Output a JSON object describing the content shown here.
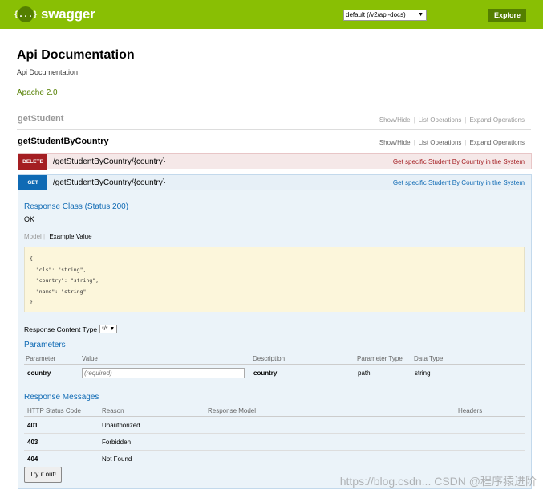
{
  "header": {
    "logo_icon": "{...}",
    "logo_text": "swagger",
    "api_select": "default (/v2/api-docs)",
    "api_select_arrow": "▼",
    "explore": "Explore",
    "bg_color": "#89bf04"
  },
  "info": {
    "title": "Api Documentation",
    "description": "Api Documentation",
    "license": "Apache 2.0"
  },
  "resources": [
    {
      "name": "getStudent",
      "actions": [
        "Show/Hide",
        "List Operations",
        "Expand Operations"
      ]
    },
    {
      "name": "getStudentByCountry",
      "actions": [
        "Show/Hide",
        "List Operations",
        "Expand Operations"
      ]
    }
  ],
  "operations": {
    "delete": {
      "method": "DELETE",
      "path": "/getStudentByCountry/{country}",
      "summary": "Get specific Student By Country in the System",
      "color": "#a41e22"
    },
    "get": {
      "method": "GET",
      "path": "/getStudentByCountry/{country}",
      "summary": "Get specific Student By Country in the System",
      "color": "#0f6ab4"
    }
  },
  "response_class": {
    "title": "Response Class (Status 200)",
    "value": "OK",
    "tab_model": "Model",
    "tab_example": "Example Value",
    "example": "{\n  \"cls\": \"string\",\n  \"country\": \"string\",\n  \"name\": \"string\"\n}"
  },
  "content_type": {
    "label": "Response Content Type",
    "value": "*/*"
  },
  "parameters": {
    "title": "Parameters",
    "headers": [
      "Parameter",
      "Value",
      "Description",
      "Parameter Type",
      "Data Type"
    ],
    "rows": [
      {
        "name": "country",
        "placeholder": "(required)",
        "description": "country",
        "type": "path",
        "data_type": "string"
      }
    ]
  },
  "messages": {
    "title": "Response Messages",
    "headers": [
      "HTTP Status Code",
      "Reason",
      "Response Model",
      "Headers"
    ],
    "rows": [
      {
        "code": "401",
        "reason": "Unauthorized"
      },
      {
        "code": "403",
        "reason": "Forbidden"
      },
      {
        "code": "404",
        "reason": "Not Found"
      }
    ]
  },
  "try_button": "Try it out!",
  "watermark": "https://blog.csdn... CSDN @程序猿进阶"
}
